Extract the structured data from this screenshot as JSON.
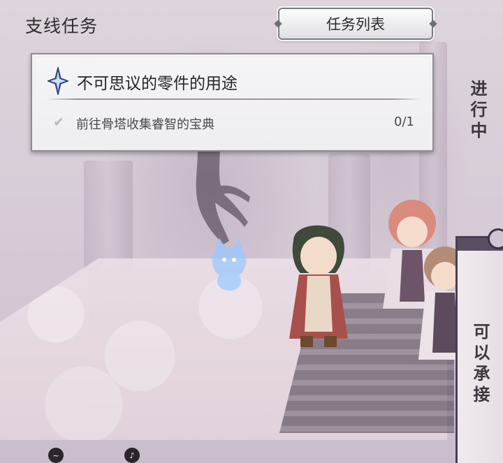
{
  "header": {
    "section_title": "支线任务",
    "list_button_label": "任务列表"
  },
  "quest": {
    "emblem_icon": "crystal-star-icon",
    "title": "不可思议的零件的用途",
    "objective": "前往骨塔收集睿智的宝典",
    "check_icon": "checkmark-icon",
    "progress": "0/1"
  },
  "status": {
    "in_progress_label": "进行中",
    "available_label": "可以承接"
  },
  "controls": {
    "left_icon": "tilde-button-icon",
    "left_glyph": "~",
    "right_icon": "music-note-button-icon",
    "right_glyph": "♪"
  },
  "colors": {
    "panel_bg": "#f5f4f6",
    "panel_border": "#8f8c96",
    "tab_bar": "#5a4e62",
    "scene_tint": "#ddd4dd"
  }
}
